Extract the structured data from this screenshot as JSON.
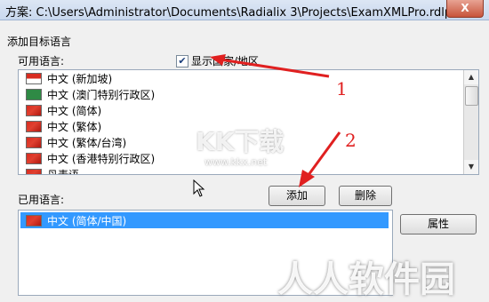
{
  "window": {
    "title": "方案: C:\\Users\\Administrator\\Documents\\Radialix 3\\Projects\\ExamXMLPro.rdlp",
    "close_label": "X"
  },
  "section": {
    "label": "添加目标语言"
  },
  "available": {
    "label": "可用语言:",
    "show_regions_label": "显示国家/地区",
    "show_regions_checked": true,
    "items": [
      {
        "label": "中文 (新加坡)",
        "flag": "red-white"
      },
      {
        "label": "中文 (澳门特别行政区)",
        "flag": "green"
      },
      {
        "label": "中文 (简体)",
        "flag": "red"
      },
      {
        "label": "中文 (繁体)",
        "flag": "red"
      },
      {
        "label": "中文 (繁体/台湾)",
        "flag": "red"
      },
      {
        "label": "中文 (香港特别行政区)",
        "flag": "red"
      },
      {
        "label": "丹麦语",
        "flag": "red"
      }
    ]
  },
  "buttons": {
    "add": "添加",
    "delete": "删除",
    "properties": "属性"
  },
  "used": {
    "label": "已用语言:",
    "items": [
      {
        "label": "中文 (简体/中国)",
        "flag": "red",
        "selected": true
      }
    ]
  },
  "annotations": {
    "step1": "1",
    "step2": "2",
    "color": "#e02020"
  },
  "watermark": {
    "center": "KK下载",
    "url": "www.kkx.net",
    "corner": "人人软件园"
  }
}
